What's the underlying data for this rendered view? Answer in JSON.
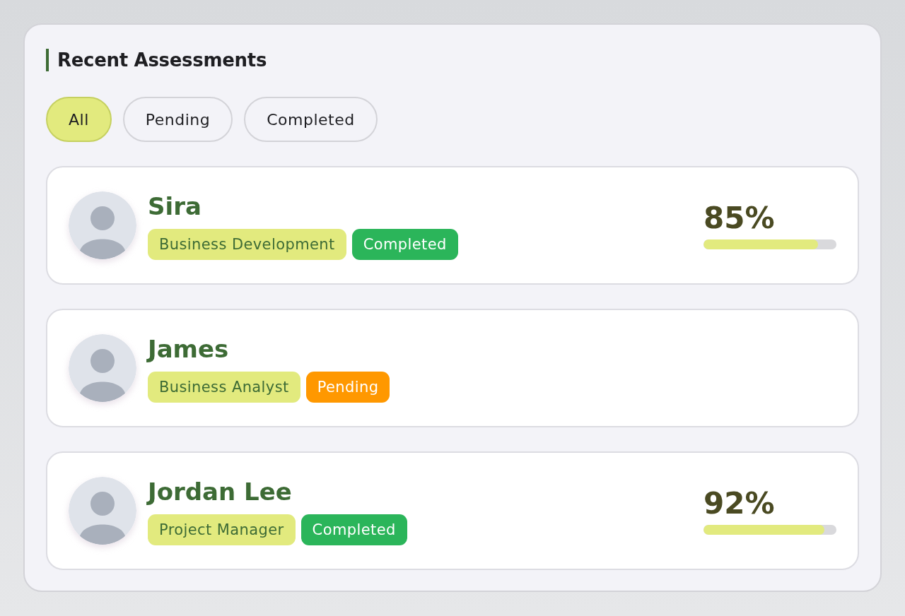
{
  "title": "Recent Assessments",
  "filters": [
    {
      "label": "All",
      "selected": true
    },
    {
      "label": "Pending",
      "selected": false
    },
    {
      "label": "Completed",
      "selected": false
    }
  ],
  "assessments": [
    {
      "name": "Sira",
      "role": "Business Development",
      "status": {
        "label": "Completed",
        "color": "#2bb55a"
      },
      "score": {
        "reading": "85%",
        "level": 0.86
      }
    },
    {
      "name": "James",
      "role": "Business Analyst",
      "status": {
        "label": "Pending",
        "color": "#ff9800"
      }
    },
    {
      "name": "Jordan Lee",
      "role": "Project Manager",
      "status": {
        "label": "Completed",
        "color": "#2bb55a"
      },
      "score": {
        "reading": "92%",
        "level": 0.91
      }
    }
  ]
}
